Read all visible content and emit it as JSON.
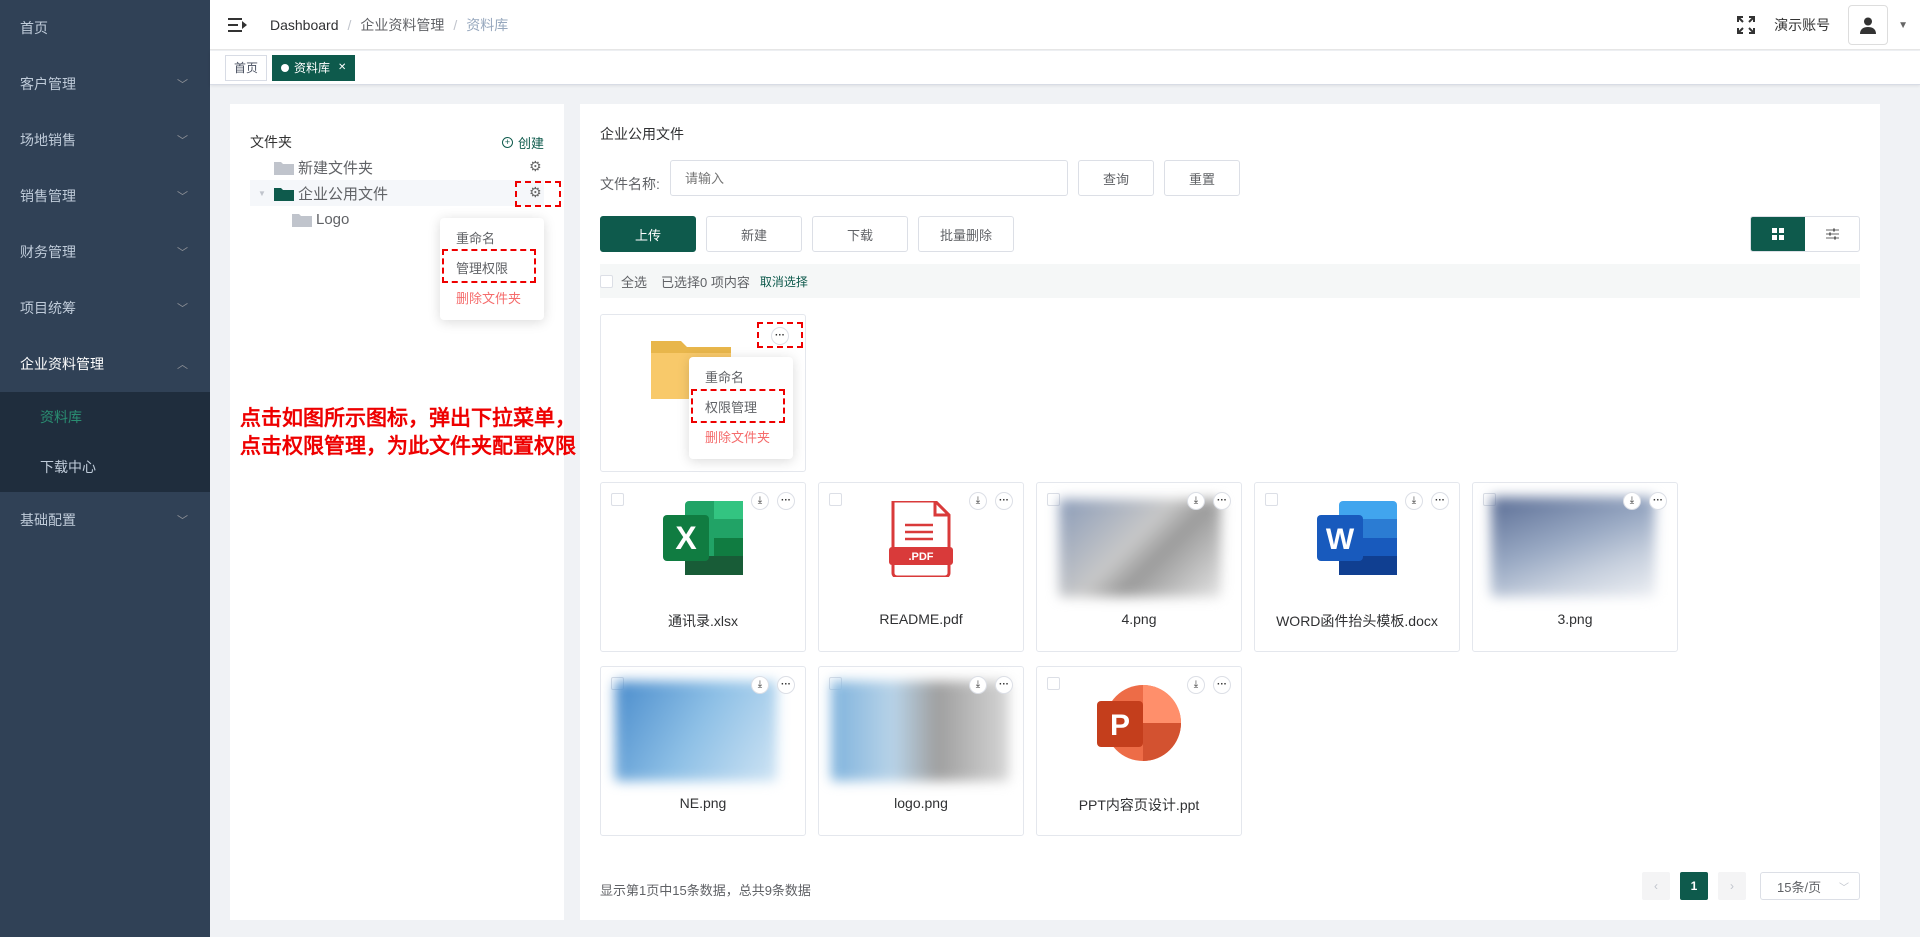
{
  "sidebar": {
    "items": [
      {
        "label": "首页",
        "has_children": false
      },
      {
        "label": "客户管理",
        "has_children": true
      },
      {
        "label": "场地销售",
        "has_children": true
      },
      {
        "label": "销售管理",
        "has_children": true
      },
      {
        "label": "财务管理",
        "has_children": true
      },
      {
        "label": "项目统筹",
        "has_children": true
      },
      {
        "label": "企业资料管理",
        "has_children": true,
        "open": true
      },
      {
        "label": "基础配置",
        "has_children": true
      }
    ],
    "sub_items": [
      "资料库",
      "下载中心"
    ]
  },
  "header": {
    "breadcrumb": [
      "Dashboard",
      "企业资料管理",
      "资料库"
    ],
    "user_name": "演示账号"
  },
  "tags": [
    {
      "label": "首页",
      "active": false
    },
    {
      "label": "资料库",
      "active": true,
      "closable": true
    }
  ],
  "folders": {
    "title": "文件夹",
    "create_label": "创建",
    "tree": [
      {
        "label": "新建文件夹"
      },
      {
        "label": "企业公用文件"
      },
      {
        "label": "Logo"
      }
    ],
    "menu": [
      "重命名",
      "管理权限",
      "删除文件夹"
    ]
  },
  "files": {
    "title": "企业公用文件",
    "search_label": "文件名称:",
    "search_placeholder": "请输入",
    "query_label": "查询",
    "reset_label": "重置",
    "upload_label": "上传",
    "new_label": "新建",
    "download_label": "下载",
    "batch_delete_label": "批量删除",
    "select_all_label": "全选",
    "selected_text": "已选择0 项内容",
    "cancel_select_label": "取消选择",
    "folder_menu": [
      "重命名",
      "权限管理",
      "删除文件夹"
    ],
    "items": [
      {
        "name": "通讯录.xlsx",
        "type": "excel-icon"
      },
      {
        "name": "README.pdf",
        "type": "pdf-icon"
      },
      {
        "name": "4.png",
        "type": "image"
      },
      {
        "name": "WORD函件抬头模板.docx",
        "type": "word-icon"
      },
      {
        "name": "3.png",
        "type": "image"
      },
      {
        "name": "NE.png",
        "type": "image"
      },
      {
        "name": "logo.png",
        "type": "image"
      },
      {
        "name": "PPT内容页设计.ppt",
        "type": "powerpoint-icon"
      }
    ]
  },
  "annotation": {
    "line1": "点击如图所示图标，弹出下拉菜单，",
    "line2": "点击权限管理，为此文件夹配置权限"
  },
  "pagination": {
    "info": "显示第1页中15条数据，总共9条数据",
    "current_page": "1",
    "page_size": "15条/页"
  },
  "colors": {
    "primary": "#0e5a4c",
    "sidebar_bg": "#304156",
    "danger": "#f56c6c",
    "annotation": "#ee0000"
  }
}
